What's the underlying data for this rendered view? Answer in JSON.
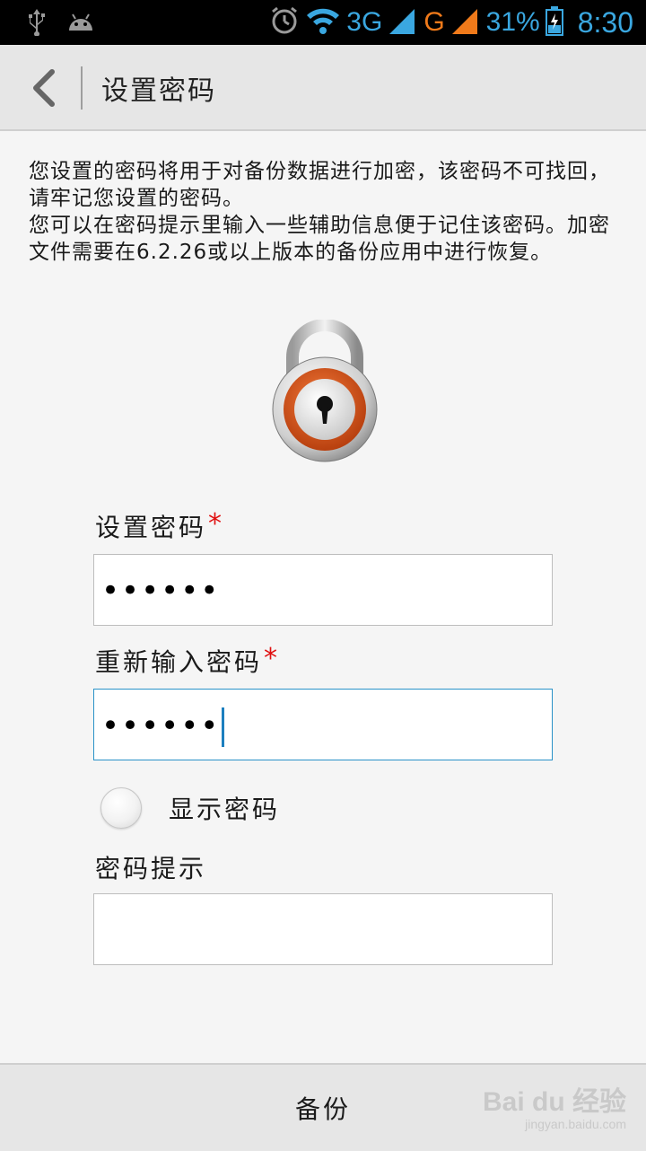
{
  "status_bar": {
    "network1": "3G",
    "network2": "G",
    "battery": "31%",
    "time": "8:30",
    "icons": [
      "usb-icon",
      "android-icon",
      "alarm-icon",
      "wifi-icon",
      "signal-icon",
      "battery-icon"
    ]
  },
  "header": {
    "title": "设置密码",
    "back_icon": "chevron-left-icon"
  },
  "description": {
    "line1": "您设置的密码将用于对备份数据进行加密，该密码不可找回，请牢记您设置的密码。",
    "line2": "您可以在密码提示里输入一些辅助信息便于记住该密码。加密文件需要在6.2.26或以上版本的备份应用中进行恢复。"
  },
  "form": {
    "password_label": "设置密码",
    "password_value": "••••••",
    "confirm_label": "重新输入密码",
    "confirm_value": "••••••",
    "required_mark": "*",
    "show_password_label": "显示密码",
    "show_password_checked": false,
    "hint_label": "密码提示",
    "hint_value": ""
  },
  "footer": {
    "backup_label": "备份",
    "watermark_logo": "Bai du 经验",
    "watermark_url": "jingyan.baidu.com"
  },
  "colors": {
    "accent": "#3aa7e0",
    "required": "#e01010",
    "lock_ring": "#e0571c",
    "focus_border": "#2a92c8"
  }
}
